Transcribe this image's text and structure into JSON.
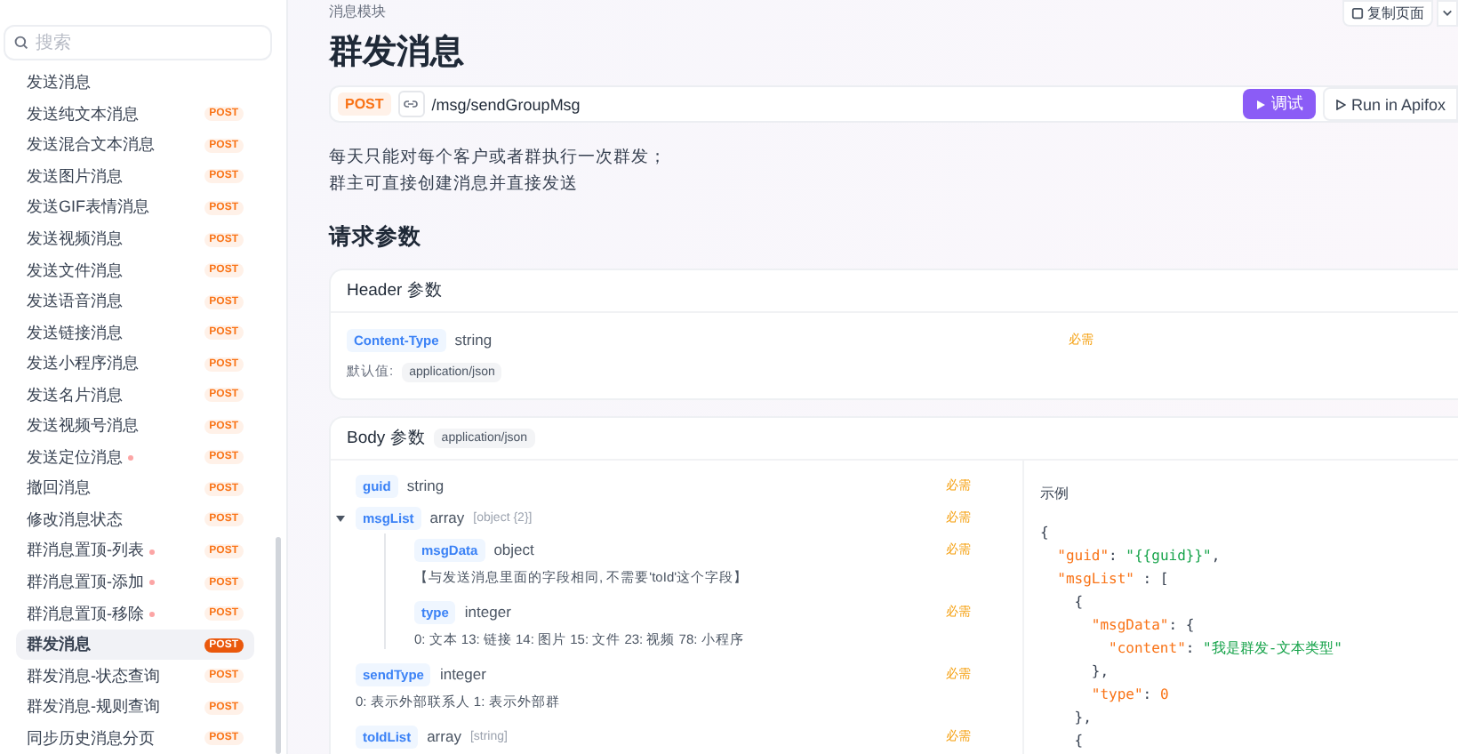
{
  "sidebar": {
    "search": {
      "placeholder": "搜索"
    },
    "items": [
      {
        "label": "发送消息",
        "dot": false,
        "selected": false
      },
      {
        "label": "发送纯文本消息",
        "method": "POST",
        "dot": false,
        "selected": false
      },
      {
        "label": "发送混合文本消息",
        "method": "POST",
        "dot": false,
        "selected": false
      },
      {
        "label": "发送图片消息",
        "method": "POST",
        "dot": false,
        "selected": false
      },
      {
        "label": "发送GIF表情消息",
        "method": "POST",
        "dot": false,
        "selected": false
      },
      {
        "label": "发送视频消息",
        "method": "POST",
        "dot": false,
        "selected": false
      },
      {
        "label": "发送文件消息",
        "method": "POST",
        "dot": false,
        "selected": false
      },
      {
        "label": "发送语音消息",
        "method": "POST",
        "dot": false,
        "selected": false
      },
      {
        "label": "发送链接消息",
        "method": "POST",
        "dot": false,
        "selected": false
      },
      {
        "label": "发送小程序消息",
        "method": "POST",
        "dot": false,
        "selected": false
      },
      {
        "label": "发送名片消息",
        "method": "POST",
        "dot": false,
        "selected": false
      },
      {
        "label": "发送视频号消息",
        "method": "POST",
        "dot": false,
        "selected": false
      },
      {
        "label": "发送定位消息",
        "method": "POST",
        "dot": true,
        "selected": false
      },
      {
        "label": "撤回消息",
        "method": "POST",
        "dot": false,
        "selected": false
      },
      {
        "label": "修改消息状态",
        "method": "POST",
        "dot": false,
        "selected": false
      },
      {
        "label": "群消息置顶-列表",
        "method": "POST",
        "dot": true,
        "selected": false
      },
      {
        "label": "群消息置顶-添加",
        "method": "POST",
        "dot": true,
        "selected": false
      },
      {
        "label": "群消息置顶-移除",
        "method": "POST",
        "dot": true,
        "selected": false
      },
      {
        "label": "群发消息",
        "method": "POST",
        "dot": false,
        "selected": true
      },
      {
        "label": "群发消息-状态查询",
        "method": "POST",
        "dot": false,
        "selected": false
      },
      {
        "label": "群发消息-规则查询",
        "method": "POST",
        "dot": false,
        "selected": false
      },
      {
        "label": "同步历史消息分页",
        "method": "POST",
        "dot": false,
        "selected": false
      }
    ]
  },
  "breadcrumb": "消息模块",
  "copy_button": "复制页面",
  "title": "群发消息",
  "endpoint": {
    "method": "POST",
    "path": "/msg/sendGroupMsg",
    "debug_button": "调试",
    "run_button": "Run in Apifox"
  },
  "description": [
    "每天只能对每个客户或者群执行一次群发；",
    "群主可直接创建消息并直接发送"
  ],
  "params_heading": "请求参数",
  "header_params": {
    "title": "Header 参数",
    "fields": [
      {
        "name": "Content-Type",
        "type": "string",
        "required": "必需",
        "default_label": "默认值:",
        "default_value": "application/json"
      }
    ]
  },
  "body_params": {
    "title": "Body 参数",
    "content_type": "application/json",
    "fields": [
      {
        "name": "guid",
        "type": "string",
        "required": "必需"
      },
      {
        "name": "msgList",
        "type": "array",
        "type_extra": "[object {2}]",
        "required": "必需",
        "expanded": true,
        "children": [
          {
            "name": "msgData",
            "type": "object",
            "required": "必需",
            "description": "【与发送消息里面的字段相同, 不需要'toId'这个字段】"
          },
          {
            "name": "type",
            "type": "integer",
            "required": "必需",
            "description": "0: 文本 13: 链接 14: 图片 15: 文件 23: 视频 78: 小程序"
          }
        ]
      },
      {
        "name": "sendType",
        "type": "integer",
        "required": "必需",
        "description": "0: 表示外部联系人 1: 表示外部群"
      },
      {
        "name": "toIdList",
        "type": "array",
        "type_extra": "[string]",
        "required": "必需"
      }
    ],
    "example": {
      "title": "示例",
      "lines": [
        [
          {
            "kind": "punct",
            "text": "{"
          }
        ],
        [
          {
            "kind": "key",
            "text": "  \"guid\""
          },
          {
            "kind": "punct",
            "text": ": "
          },
          {
            "kind": "str",
            "text": "\"{{guid}}\""
          },
          {
            "kind": "punct",
            "text": ","
          }
        ],
        [
          {
            "kind": "key",
            "text": "  \"msgList\""
          },
          {
            "kind": "punct",
            "text": " : ["
          }
        ],
        [
          {
            "kind": "punct",
            "text": "    {"
          }
        ],
        [
          {
            "kind": "key",
            "text": "      \"msgData\""
          },
          {
            "kind": "punct",
            "text": ": {"
          }
        ],
        [
          {
            "kind": "key",
            "text": "        \"content\""
          },
          {
            "kind": "punct",
            "text": ": "
          },
          {
            "kind": "str",
            "text": "\"我是群发-文本类型\""
          }
        ],
        [
          {
            "kind": "punct",
            "text": "      },"
          }
        ],
        [
          {
            "kind": "key",
            "text": "      \"type\""
          },
          {
            "kind": "punct",
            "text": ": "
          },
          {
            "kind": "num",
            "text": "0"
          }
        ],
        [
          {
            "kind": "punct",
            "text": "    },"
          }
        ],
        [
          {
            "kind": "punct",
            "text": "    {"
          }
        ]
      ]
    }
  }
}
